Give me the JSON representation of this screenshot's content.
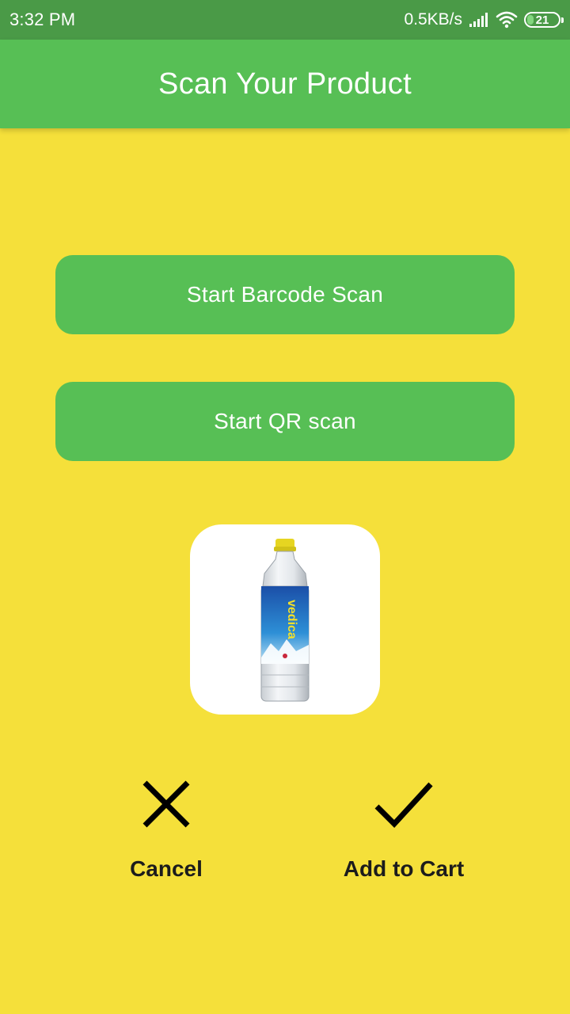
{
  "status_bar": {
    "time": "3:32 PM",
    "network_speed": "0.5KB/s",
    "battery_level": "21",
    "battery_fraction": 0.21,
    "icons": [
      "signal-icon",
      "wifi-icon",
      "battery-icon"
    ]
  },
  "header": {
    "title": "Scan Your Product"
  },
  "buttons": {
    "barcode_label": "Start Barcode Scan",
    "qr_label": "Start QR scan"
  },
  "product": {
    "image_icon": "water-bottle-image",
    "brand_text": "vedica"
  },
  "actions": {
    "cancel_label": "Cancel",
    "cancel_icon": "close-icon",
    "add_label": "Add to Cart",
    "add_icon": "check-icon"
  },
  "colors": {
    "status_bar": "#4A9A47",
    "app_bar": "#57BF55",
    "background": "#F5E03A",
    "button": "#57BF55",
    "button_text": "#FFFFFF",
    "label_text": "#1C1C1C"
  }
}
